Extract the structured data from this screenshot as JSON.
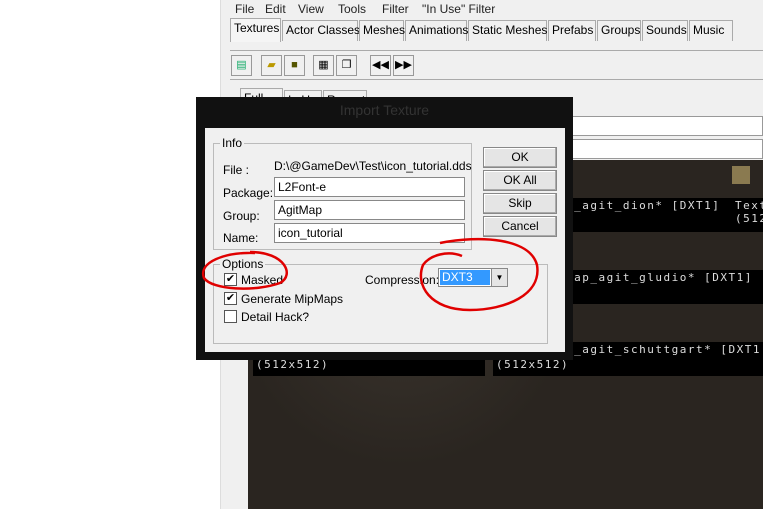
{
  "menu": [
    "File",
    "Edit",
    "View",
    "Tools",
    "Filter",
    "\"In Use\" Filter"
  ],
  "tabs": [
    "Textures",
    "Actor Classes",
    "Meshes",
    "Animations",
    "Static Meshes",
    "Prefabs",
    "Groups",
    "Sounds",
    "Music"
  ],
  "active_tab": "Textures",
  "subtabs": [
    "Full",
    "In Use",
    "Recent"
  ],
  "toolbar_icons": [
    "browser-icon",
    "open-icon",
    "save-icon",
    "properties-icon",
    "copy-icon",
    "rewind-icon",
    "forward-icon"
  ],
  "textures": [
    {
      "name": "p_agit_dion* [DXT1]",
      "size": ""
    },
    {
      "name": "Text",
      "size": "(512"
    },
    {
      "name": "map_agit_gludio* [DXT1]",
      "size": ")"
    },
    {
      "name": "p_agit_schuttgart* [DXT1",
      "size": ""
    },
    {
      "name": "",
      "size": "(512x512)"
    },
    {
      "name": "",
      "size": "(512x512)"
    }
  ],
  "dialog": {
    "title": "Import Texture",
    "info_label": "Info",
    "file_label": "File :",
    "file_value": "D:\\@GameDev\\Test\\icon_tutorial.dds",
    "package_label": "Package:",
    "package_value": "L2Font-e",
    "group_label": "Group:",
    "group_value": "AgitMap",
    "name_label": "Name:",
    "name_value": "icon_tutorial",
    "buttons": [
      "OK",
      "OK All",
      "Skip",
      "Cancel"
    ],
    "options_label": "Options",
    "masked_label": "Masked",
    "masked": true,
    "mipmaps_label": "Generate MipMaps",
    "mipmaps": true,
    "detail_label": "Detail Hack?",
    "detail": false,
    "compression_label": "Compression:",
    "compression_value": "DXT3"
  },
  "annotation_color": "#e00000",
  "selection_color": "#3399ff"
}
